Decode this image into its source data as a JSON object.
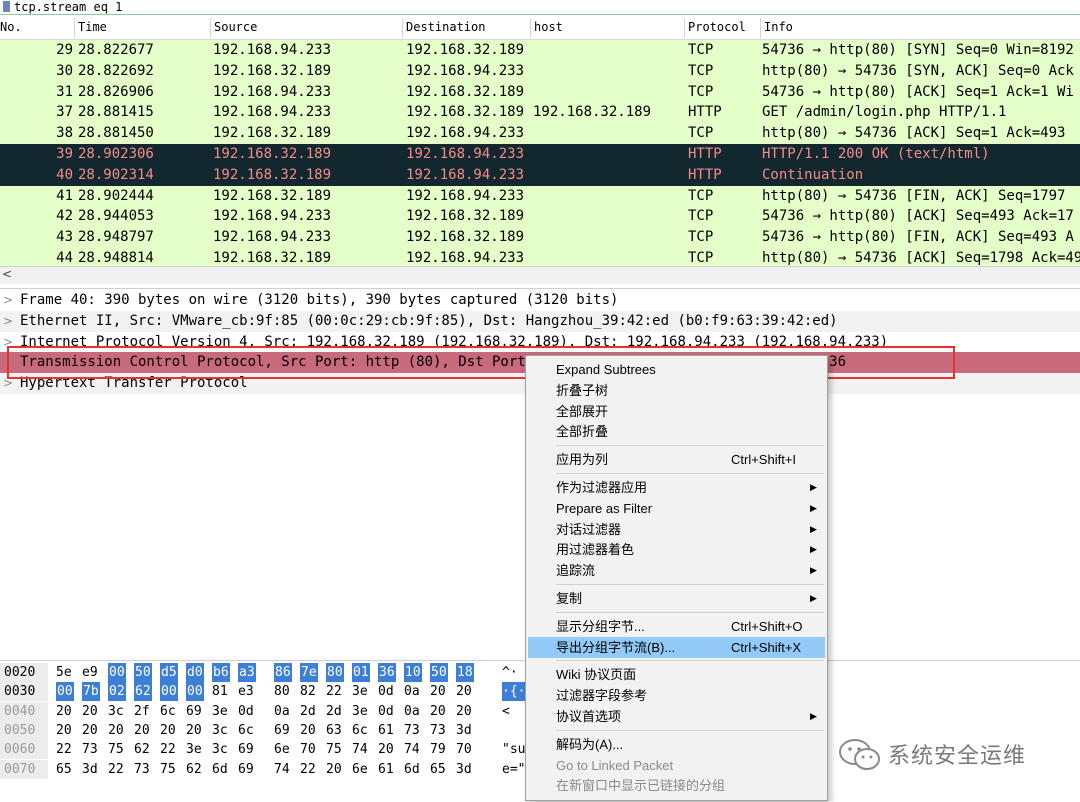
{
  "filter": {
    "text": "tcp.stream eq 1"
  },
  "packet_list": {
    "columns": [
      "No.",
      "Time",
      "Source",
      "Destination",
      "host",
      "Protocol",
      "Info"
    ],
    "rows": [
      {
        "no": "29",
        "time": "28.822677",
        "src": "192.168.94.233",
        "dst": "192.168.32.189",
        "host": "",
        "proto": "TCP",
        "info": "54736 → http(80) [SYN] Seq=0 Win=8192",
        "style": "light"
      },
      {
        "no": "30",
        "time": "28.822692",
        "src": "192.168.32.189",
        "dst": "192.168.94.233",
        "host": "",
        "proto": "TCP",
        "info": "http(80) → 54736 [SYN, ACK] Seq=0 Ack",
        "style": "light"
      },
      {
        "no": "31",
        "time": "28.826906",
        "src": "192.168.94.233",
        "dst": "192.168.32.189",
        "host": "",
        "proto": "TCP",
        "info": "54736 → http(80) [ACK] Seq=1 Ack=1 Wi",
        "style": "light"
      },
      {
        "no": "37",
        "time": "28.881415",
        "src": "192.168.94.233",
        "dst": "192.168.32.189",
        "host": "192.168.32.189",
        "proto": "HTTP",
        "info": "GET /admin/login.php HTTP/1.1",
        "style": "light"
      },
      {
        "no": "38",
        "time": "28.881450",
        "src": "192.168.32.189",
        "dst": "192.168.94.233",
        "host": "",
        "proto": "TCP",
        "info": "http(80) → 54736 [ACK] Seq=1 Ack=493",
        "style": "light"
      },
      {
        "no": "39",
        "time": "28.902306",
        "src": "192.168.32.189",
        "dst": "192.168.94.233",
        "host": "",
        "proto": "HTTP",
        "info": "HTTP/1.1 200 OK  (text/html)",
        "style": "dark"
      },
      {
        "no": "40",
        "time": "28.902314",
        "src": "192.168.32.189",
        "dst": "192.168.94.233",
        "host": "",
        "proto": "HTTP",
        "info": "Continuation",
        "style": "dark"
      },
      {
        "no": "41",
        "time": "28.902444",
        "src": "192.168.32.189",
        "dst": "192.168.94.233",
        "host": "",
        "proto": "TCP",
        "info": "http(80) → 54736 [FIN, ACK] Seq=1797",
        "style": "light"
      },
      {
        "no": "42",
        "time": "28.944053",
        "src": "192.168.94.233",
        "dst": "192.168.32.189",
        "host": "",
        "proto": "TCP",
        "info": "54736 → http(80) [ACK] Seq=493 Ack=17",
        "style": "light"
      },
      {
        "no": "43",
        "time": "28.948797",
        "src": "192.168.94.233",
        "dst": "192.168.32.189",
        "host": "",
        "proto": "TCP",
        "info": "54736 → http(80) [FIN, ACK] Seq=493 A",
        "style": "light"
      },
      {
        "no": "44",
        "time": "28.948814",
        "src": "192.168.32.189",
        "dst": "192.168.94.233",
        "host": "",
        "proto": "TCP",
        "info": "http(80) → 54736 [ACK] Seq=1798 Ack=49",
        "style": "light"
      }
    ]
  },
  "scroll": {
    "left_arrow": "<"
  },
  "details": [
    {
      "text": "Frame 40: 390 bytes on wire (3120 bits), 390 bytes captured (3120 bits)",
      "style": "plain"
    },
    {
      "text": "Ethernet II, Src: VMware_cb:9f:85 (00:0c:29:cb:9f:85), Dst: Hangzhou_39:42:ed (b0:f9:63:39:42:ed)",
      "style": "gray"
    },
    {
      "text": "Internet Protocol Version 4, Src: 192.168.32.189 (192.168.32.189), Dst: 192.168.94.233 (192.168.94.233)",
      "style": "plain"
    },
    {
      "text": "Transmission Control Protocol, Src Port: http (80), Dst Port: 54736, Seq: 1461, Ack: 493, Len: 336",
      "style": "sel"
    },
    {
      "text": "Hypertext Transfer Protocol",
      "style": "gray"
    }
  ],
  "bytes": [
    {
      "offset": "0020",
      "hex": [
        "5e",
        "e9",
        "00",
        "50",
        "d5",
        "d0",
        "b6",
        "a3",
        "86",
        "7e",
        "80",
        "01",
        "36",
        "10",
        "50",
        "18"
      ],
      "hl": [
        2,
        3,
        4,
        5,
        6,
        7,
        8,
        9,
        10,
        11,
        12,
        13,
        14,
        15
      ],
      "ascii": "^·",
      "ascii_hl": false,
      "dim": false
    },
    {
      "offset": "0030",
      "hex": [
        "00",
        "7b",
        "02",
        "62",
        "00",
        "00",
        "81",
        "e3",
        "80",
        "82",
        "22",
        "3e",
        "0d",
        "0a",
        "20",
        "20"
      ],
      "hl": [
        0,
        1,
        2,
        3,
        4,
        5
      ],
      "ascii": "·{·",
      "ascii_hl": true,
      "dim": false
    },
    {
      "offset": "0040",
      "hex": [
        "20",
        "20",
        "3c",
        "2f",
        "6c",
        "69",
        "3e",
        "0d",
        "0a",
        "2d",
        "2d",
        "3e",
        "0d",
        "0a",
        "20",
        "20"
      ],
      "hl": [],
      "ascii": "<",
      "ascii_hl": false,
      "dim": true
    },
    {
      "offset": "0050",
      "hex": [
        "20",
        "20",
        "20",
        "20",
        "20",
        "20",
        "3c",
        "6c",
        "69",
        "20",
        "63",
        "6c",
        "61",
        "73",
        "73",
        "3d"
      ],
      "hl": [],
      "ascii": "",
      "ascii_hl": false,
      "dim": true
    },
    {
      "offset": "0060",
      "hex": [
        "22",
        "73",
        "75",
        "62",
        "22",
        "3e",
        "3c",
        "69",
        "6e",
        "70",
        "75",
        "74",
        "20",
        "74",
        "79",
        "70"
      ],
      "hl": [],
      "ascii": "\"su",
      "ascii_hl": false,
      "dim": true
    },
    {
      "offset": "0070",
      "hex": [
        "65",
        "3d",
        "22",
        "73",
        "75",
        "62",
        "6d",
        "69",
        "74",
        "22",
        "20",
        "6e",
        "61",
        "6d",
        "65",
        "3d"
      ],
      "hl": [],
      "ascii": "e=\"",
      "ascii_hl": false,
      "dim": true
    }
  ],
  "context_menu": {
    "items": [
      {
        "label": "Expand Subtrees",
        "shortcut": "",
        "submenu": false,
        "highlight": false,
        "disabled": false
      },
      {
        "label": "折叠子树",
        "shortcut": "",
        "submenu": false,
        "highlight": false,
        "disabled": false
      },
      {
        "label": "全部展开",
        "shortcut": "",
        "submenu": false,
        "highlight": false,
        "disabled": false
      },
      {
        "label": "全部折叠",
        "shortcut": "",
        "submenu": false,
        "highlight": false,
        "disabled": false
      },
      {
        "sep": true
      },
      {
        "label": "应用为列",
        "shortcut": "Ctrl+Shift+I",
        "submenu": false,
        "highlight": false,
        "disabled": false
      },
      {
        "sep": true
      },
      {
        "label": "作为过滤器应用",
        "shortcut": "",
        "submenu": true,
        "highlight": false,
        "disabled": false
      },
      {
        "label": "Prepare as Filter",
        "shortcut": "",
        "submenu": true,
        "highlight": false,
        "disabled": false
      },
      {
        "label": "对话过滤器",
        "shortcut": "",
        "submenu": true,
        "highlight": false,
        "disabled": false
      },
      {
        "label": "用过滤器着色",
        "shortcut": "",
        "submenu": true,
        "highlight": false,
        "disabled": false
      },
      {
        "label": "追踪流",
        "shortcut": "",
        "submenu": true,
        "highlight": false,
        "disabled": false
      },
      {
        "sep": true
      },
      {
        "label": "复制",
        "shortcut": "",
        "submenu": true,
        "highlight": false,
        "disabled": false
      },
      {
        "sep": true
      },
      {
        "label": "显示分组字节...",
        "shortcut": "Ctrl+Shift+O",
        "submenu": false,
        "highlight": false,
        "disabled": false
      },
      {
        "label": "导出分组字节流(B)...",
        "shortcut": "Ctrl+Shift+X",
        "submenu": false,
        "highlight": true,
        "disabled": false
      },
      {
        "sep": true
      },
      {
        "label": "Wiki 协议页面",
        "shortcut": "",
        "submenu": false,
        "highlight": false,
        "disabled": false
      },
      {
        "label": "过滤器字段参考",
        "shortcut": "",
        "submenu": false,
        "highlight": false,
        "disabled": false
      },
      {
        "label": "协议首选项",
        "shortcut": "",
        "submenu": true,
        "highlight": false,
        "disabled": false
      },
      {
        "sep": true
      },
      {
        "label": "解码为(A)...",
        "shortcut": "",
        "submenu": false,
        "highlight": false,
        "disabled": false
      },
      {
        "label": "Go to Linked Packet",
        "shortcut": "",
        "submenu": false,
        "highlight": false,
        "disabled": true
      },
      {
        "label": "在新窗口中显示已链接的分组",
        "shortcut": "",
        "submenu": false,
        "highlight": false,
        "disabled": true
      }
    ]
  },
  "watermark": {
    "text": "系统安全运维",
    "icon": "wechat-icon"
  },
  "colors": {
    "selected_row": "#c86a7c",
    "dark_row_bg": "#12272e",
    "light_row_bg": "#e4ffc7",
    "menu_highlight": "#91c9f7",
    "callout": "#e8322e"
  }
}
